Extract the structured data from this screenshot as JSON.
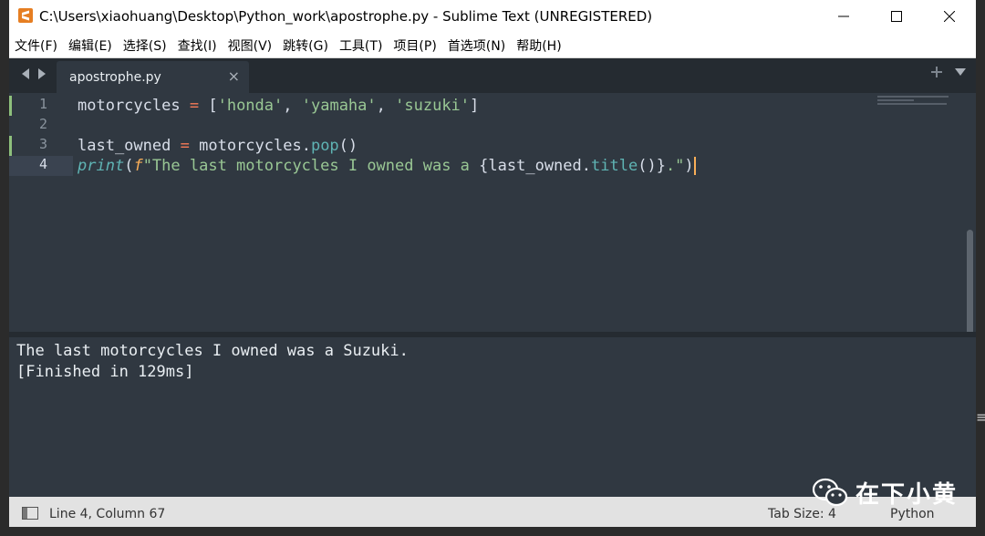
{
  "window": {
    "title": "C:\\Users\\xiaohuang\\Desktop\\Python_work\\apostrophe.py - Sublime Text (UNREGISTERED)",
    "app_icon": "sublime-text-icon"
  },
  "menubar": [
    {
      "label": "文件(F)"
    },
    {
      "label": "编辑(E)"
    },
    {
      "label": "选择(S)"
    },
    {
      "label": "查找(I)"
    },
    {
      "label": "视图(V)"
    },
    {
      "label": "跳转(G)"
    },
    {
      "label": "工具(T)"
    },
    {
      "label": "项目(P)"
    },
    {
      "label": "首选项(N)"
    },
    {
      "label": "帮助(H)"
    }
  ],
  "tabs": [
    {
      "label": "apostrophe.py",
      "close": "×",
      "active": true
    }
  ],
  "editor": {
    "line_numbers": [
      "1",
      "2",
      "3",
      "4"
    ],
    "active_line": "4",
    "lines": {
      "l1": {
        "ident": "motorcycles",
        "op": "=",
        "open": "[",
        "s1": "'honda'",
        "comma1": ",",
        "s2": "'yamaha'",
        "comma2": ",",
        "s3": "'suzuki'",
        "close": "]"
      },
      "l3": {
        "ident": "last_owned",
        "op": "=",
        "obj": "motorcycles",
        "dot": ".",
        "method": "pop",
        "parens": "()"
      },
      "l4": {
        "fn": "print",
        "open": "(",
        "fpre": "f",
        "str_a": "\"The last motorcycles I owned was a ",
        "brace_open": "{",
        "var": "last_owned",
        "dot": ".",
        "method": "title",
        "call": "()",
        "brace_close": "}",
        "str_b": ".\"",
        "close": ")"
      }
    }
  },
  "output": {
    "lines": [
      "The last motorcycles I owned was a Suzuki.",
      "[Finished in 129ms]"
    ]
  },
  "statusbar": {
    "position": "Line 4, Column 67",
    "tab_size": "Tab Size: 4",
    "syntax": "Python"
  },
  "watermark": {
    "text": "在下小黄",
    "icon": "wechat-icon"
  },
  "colors": {
    "editor_bg": "#303841",
    "tabbar_bg": "#252b31",
    "keyword_operator": "#f97b58",
    "string": "#99c794",
    "function": "#5fb4b4",
    "caret": "#f9ae58",
    "statusbar_bg": "#e2e2e2"
  }
}
